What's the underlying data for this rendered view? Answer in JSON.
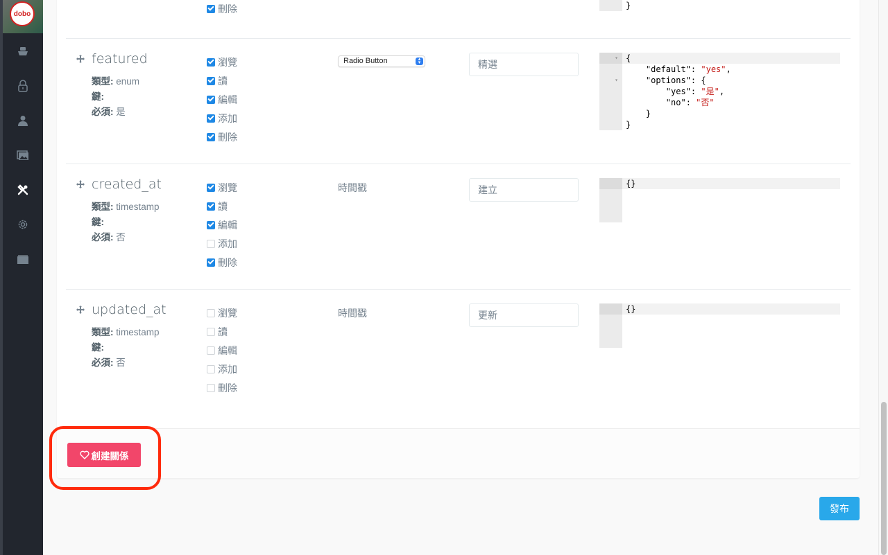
{
  "sidebar": {
    "avatar_text": "dobo",
    "items": [
      {
        "icon": "ship-icon",
        "glyph": "⛴",
        "active": false
      },
      {
        "icon": "lock-icon",
        "glyph": "🔒",
        "active": false
      },
      {
        "icon": "user-icon",
        "glyph": "👤",
        "active": false
      },
      {
        "icon": "image-icon",
        "glyph": "🖼",
        "active": false
      },
      {
        "icon": "tools-icon",
        "glyph": "🛠",
        "active": true
      },
      {
        "icon": "gear-icon",
        "glyph": "⚙",
        "active": false
      },
      {
        "icon": "folder-icon",
        "glyph": "▬",
        "active": false
      }
    ]
  },
  "labels": {
    "type": "類型",
    "key": "鍵",
    "required": "必須",
    "colon": ":"
  },
  "top_partial": {
    "perm_label": "刪除",
    "perm_checked": true,
    "json_lines": [
      "    }",
      "}"
    ]
  },
  "rows": [
    {
      "name": "featured",
      "type": "enum",
      "key": "",
      "required": "是",
      "permissions": [
        {
          "label": "瀏覽",
          "checked": true
        },
        {
          "label": "讀",
          "checked": true
        },
        {
          "label": "編輯",
          "checked": true
        },
        {
          "label": "添加",
          "checked": true
        },
        {
          "label": "刪除",
          "checked": true
        }
      ],
      "display_select": "Radio Button",
      "display_name": "精選",
      "json_lines": [
        "{",
        "    \"default\": \"yes\",",
        "    \"options\": {",
        "        \"yes\": \"是\",",
        "        \"no\": \"否\"",
        "    }",
        "}"
      ]
    },
    {
      "name": "created_at",
      "type": "timestamp",
      "key": "",
      "required": "否",
      "permissions": [
        {
          "label": "瀏覽",
          "checked": true
        },
        {
          "label": "讀",
          "checked": true
        },
        {
          "label": "編輯",
          "checked": true
        },
        {
          "label": "添加",
          "checked": false
        },
        {
          "label": "刪除",
          "checked": true
        }
      ],
      "display_type": "時間戳",
      "display_name": "建立",
      "json_lines": [
        "{}"
      ]
    },
    {
      "name": "updated_at",
      "type": "timestamp",
      "key": "",
      "required": "否",
      "permissions": [
        {
          "label": "瀏覽",
          "checked": false
        },
        {
          "label": "讀",
          "checked": false
        },
        {
          "label": "編輯",
          "checked": false
        },
        {
          "label": "添加",
          "checked": false
        },
        {
          "label": "刪除",
          "checked": false
        }
      ],
      "display_type": "時間戳",
      "display_name": "更新",
      "json_lines": [
        "{}"
      ]
    }
  ],
  "buttons": {
    "create_relation": "創建關係",
    "publish": "發布"
  },
  "colors": {
    "relation_button": "#f2466a",
    "publish_button": "#29a8ea",
    "highlight": "#ff2a0c",
    "checkbox": "#1e88e5"
  }
}
